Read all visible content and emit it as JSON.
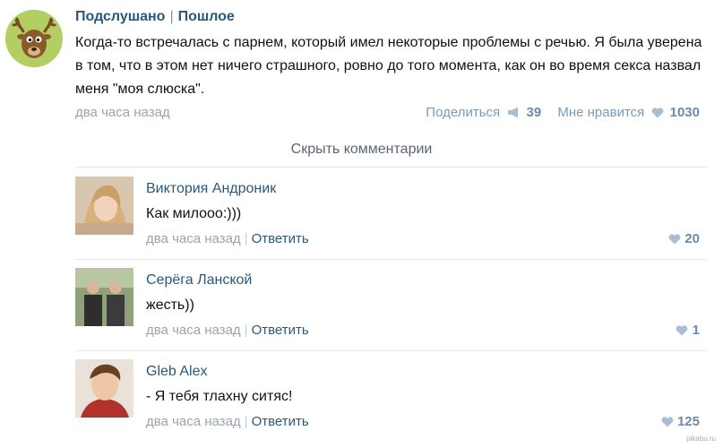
{
  "post": {
    "group_name": "Подслушано",
    "group_separator": "|",
    "group_category": "Пошлое",
    "text": "Когда-то встречалась с парнем, который имел некоторые проблемы с речью. Я была уверена в том, что в этом нет ничего страшного, ровно до того момента, как он во время секса назвал меня \"моя слюска\".",
    "time": "два часа назад",
    "share_label": "Поделиться",
    "share_count": "39",
    "like_label": "Мне нравится",
    "like_count": "1030",
    "share_icon": "megaphone-icon",
    "like_icon": "heart-icon"
  },
  "comments_toggle": "Скрыть комментарии",
  "comments": [
    {
      "author": "Виктория Андроник",
      "text": "Как милооо:)))",
      "time": "два часа назад",
      "separator": "|",
      "reply_label": "Ответить",
      "likes": "20"
    },
    {
      "author": "Серёга Ланской",
      "text": "жесть))",
      "time": "два часа назад",
      "separator": "|",
      "reply_label": "Ответить",
      "likes": "1"
    },
    {
      "author": "Gleb Alex",
      "text": "- Я тебя тлахну ситяс!",
      "time": "два часа назад",
      "separator": "|",
      "reply_label": "Ответить",
      "likes": "125"
    }
  ],
  "watermark": "pikabu.ru",
  "colors": {
    "link": "#2b587a",
    "muted": "#9aa3ae",
    "accent": "#6c8aab"
  }
}
